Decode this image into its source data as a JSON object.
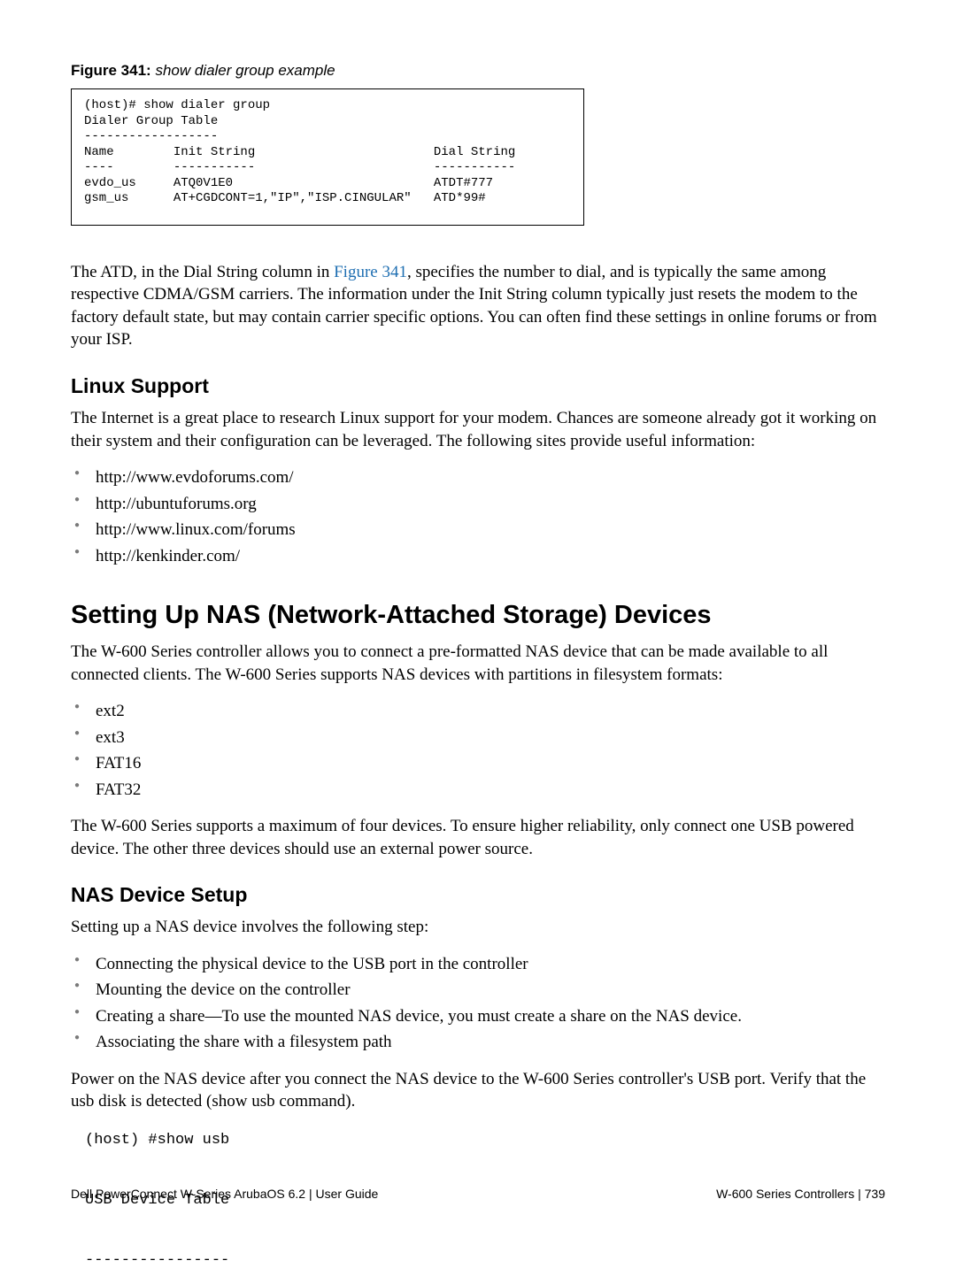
{
  "figure": {
    "label": "Figure 341:",
    "title": "show dialer group example",
    "code": "(host)# show dialer group\nDialer Group Table\n------------------\nName        Init String                        Dial String\n----        -----------                        -----------\nevdo_us     ATQ0V1E0                           ATDT#777\ngsm_us      AT+CGDCONT=1,\"IP\",\"ISP.CINGULAR\"   ATD*99#"
  },
  "para1_a": "The ATD, in the Dial String column in ",
  "para1_link": "Figure 341",
  "para1_b": ", specifies the number to dial, and is typically the same among respective CDMA/GSM carriers. The information under the Init String column typically just resets the modem to the factory default state, but may contain carrier specific options. You can often find these settings in online forums or from your ISP.",
  "linux": {
    "heading": "Linux Support",
    "para": "The Internet is a great place to research Linux support for your modem. Chances are someone already got it working on their system and their configuration can be leveraged. The following sites provide useful information:",
    "links": [
      "http://www.evdoforums.com/",
      "http://ubuntuforums.org",
      "http://www.linux.com/forums",
      "http://kenkinder.com/"
    ]
  },
  "nas": {
    "heading": "Setting Up NAS (Network-Attached Storage) Devices",
    "para1": "The W-600 Series  controller allows you to connect a pre-formatted NAS device that can be made available to all connected clients. The W-600 Series supports NAS devices with partitions in filesystem formats:",
    "fs": [
      "ext2",
      "ext3",
      "FAT16",
      "FAT32"
    ],
    "para2": "The W-600 Series supports a maximum of four devices. To ensure higher reliability, only connect one USB powered device. The other three devices should use an external power source."
  },
  "setup": {
    "heading": "NAS Device Setup",
    "para1": "Setting up a NAS device involves the following step:",
    "steps": [
      "Connecting the physical device to the USB port in the controller",
      "Mounting the device on the controller",
      "Creating a share—To use the mounted NAS device, you must create a share on the NAS device.",
      "Associating the share with a filesystem path"
    ],
    "para2": "Power on the NAS device after you connect the NAS device to the W-600 Series  controller's USB port. Verify that the usb disk is detected (show usb command).",
    "cmd": "(host) #show usb\n\nUSB Device Table\n\n----------------"
  },
  "footer": {
    "left": "Dell PowerConnect W-Series ArubaOS 6.2 | User Guide",
    "right_a": "W-600 Series Controllers |",
    "right_b": "739"
  }
}
